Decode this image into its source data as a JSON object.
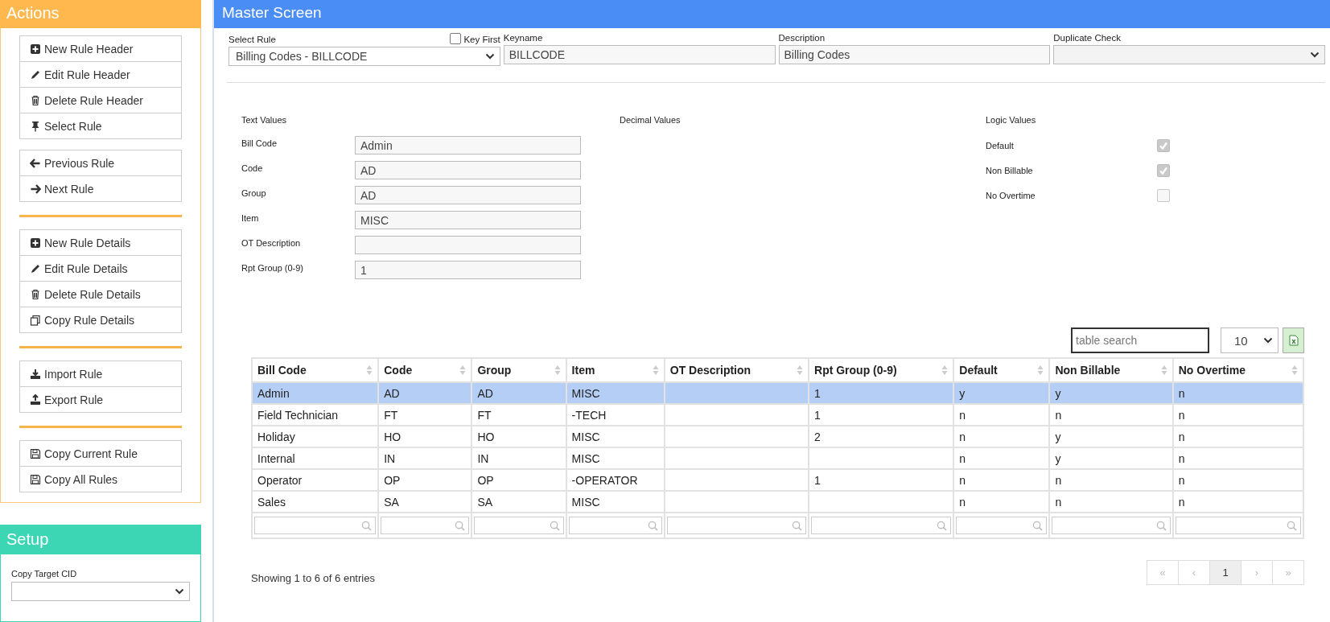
{
  "sidebar": {
    "actions": {
      "title": "Actions",
      "groups": [
        {
          "rule_above": false,
          "buttons": [
            "New Rule Header",
            "Edit Rule Header",
            "Delete Rule Header",
            "Select Rule"
          ]
        },
        {
          "rule_above": false,
          "buttons": [
            "Previous Rule",
            "Next Rule"
          ]
        },
        {
          "rule_above": true,
          "buttons": [
            "New Rule Details",
            "Edit Rule Details",
            "Delete Rule Details",
            "Copy Rule Details"
          ]
        },
        {
          "rule_above": true,
          "buttons": [
            "Import Rule",
            "Export Rule"
          ]
        },
        {
          "rule_above": true,
          "buttons": [
            "Copy Current Rule",
            "Copy All Rules"
          ]
        }
      ]
    },
    "setup": {
      "title": "Setup",
      "field_label": "Copy Target CID"
    }
  },
  "main": {
    "title": "Master Screen",
    "header_fields": {
      "select_rule": {
        "label": "Select Rule",
        "value": "Billing Codes - BILLCODE"
      },
      "key_first": {
        "label": "Key First",
        "checked": false
      },
      "keyname": {
        "label": "Keyname",
        "value": "BILLCODE"
      },
      "description": {
        "label": "Description",
        "value": "Billing Codes"
      },
      "duplicate_check": {
        "label": "Duplicate Check"
      }
    },
    "text_values": {
      "title": "Text Values",
      "fields": [
        {
          "label": "Bill Code",
          "value": "Admin"
        },
        {
          "label": "Code",
          "value": "AD"
        },
        {
          "label": "Group",
          "value": "AD"
        },
        {
          "label": "Item",
          "value": "MISC"
        },
        {
          "label": "OT Description"
        },
        {
          "label": "Rpt Group (0-9)",
          "value": "1"
        }
      ]
    },
    "decimal_values": {
      "title": "Decimal Values"
    },
    "logic_values": {
      "title": "Logic Values",
      "fields": [
        {
          "label": "Default",
          "checked": true,
          "disabled": true
        },
        {
          "label": "Non Billable",
          "checked": true,
          "disabled": true
        },
        {
          "label": "No Overtime",
          "checked": false,
          "disabled": true
        }
      ]
    },
    "table_search": {
      "placeholder": "table search"
    },
    "page_size": "10",
    "table": {
      "columns": [
        "Bill Code",
        "Code",
        "Group",
        "Item",
        "OT Description",
        "Rpt Group (0-9)",
        "Default",
        "Non Billable",
        "No Overtime"
      ],
      "rows": [
        {
          "selected": true,
          "cells": [
            "Admin",
            "AD",
            "AD",
            "MISC",
            "",
            "1",
            "y",
            "y",
            "n"
          ]
        },
        {
          "selected": false,
          "cells": [
            "Field Technician",
            "FT",
            "FT",
            "-TECH",
            "",
            "1",
            "n",
            "n",
            "n"
          ]
        },
        {
          "selected": false,
          "cells": [
            "Holiday",
            "HO",
            "HO",
            "MISC",
            "",
            "2",
            "n",
            "y",
            "n"
          ]
        },
        {
          "selected": false,
          "cells": [
            "Internal",
            "IN",
            "IN",
            "MISC",
            "",
            "",
            "n",
            "y",
            "n"
          ]
        },
        {
          "selected": false,
          "cells": [
            "Operator",
            "OP",
            "OP",
            "-OPERATOR",
            "",
            "1",
            "n",
            "n",
            "n"
          ]
        },
        {
          "selected": false,
          "cells": [
            "Sales",
            "SA",
            "SA",
            "MISC",
            "",
            "",
            "n",
            "n",
            "n"
          ]
        }
      ]
    },
    "info": "Showing 1 to 6 of 6 entries",
    "pagination": [
      {
        "label": "«",
        "selected": false,
        "disabled": true
      },
      {
        "label": "‹",
        "selected": false,
        "disabled": true
      },
      {
        "label": "1",
        "selected": true,
        "disabled": false
      },
      {
        "label": "›",
        "selected": false,
        "disabled": true
      },
      {
        "label": "»",
        "selected": false,
        "disabled": true
      }
    ]
  }
}
